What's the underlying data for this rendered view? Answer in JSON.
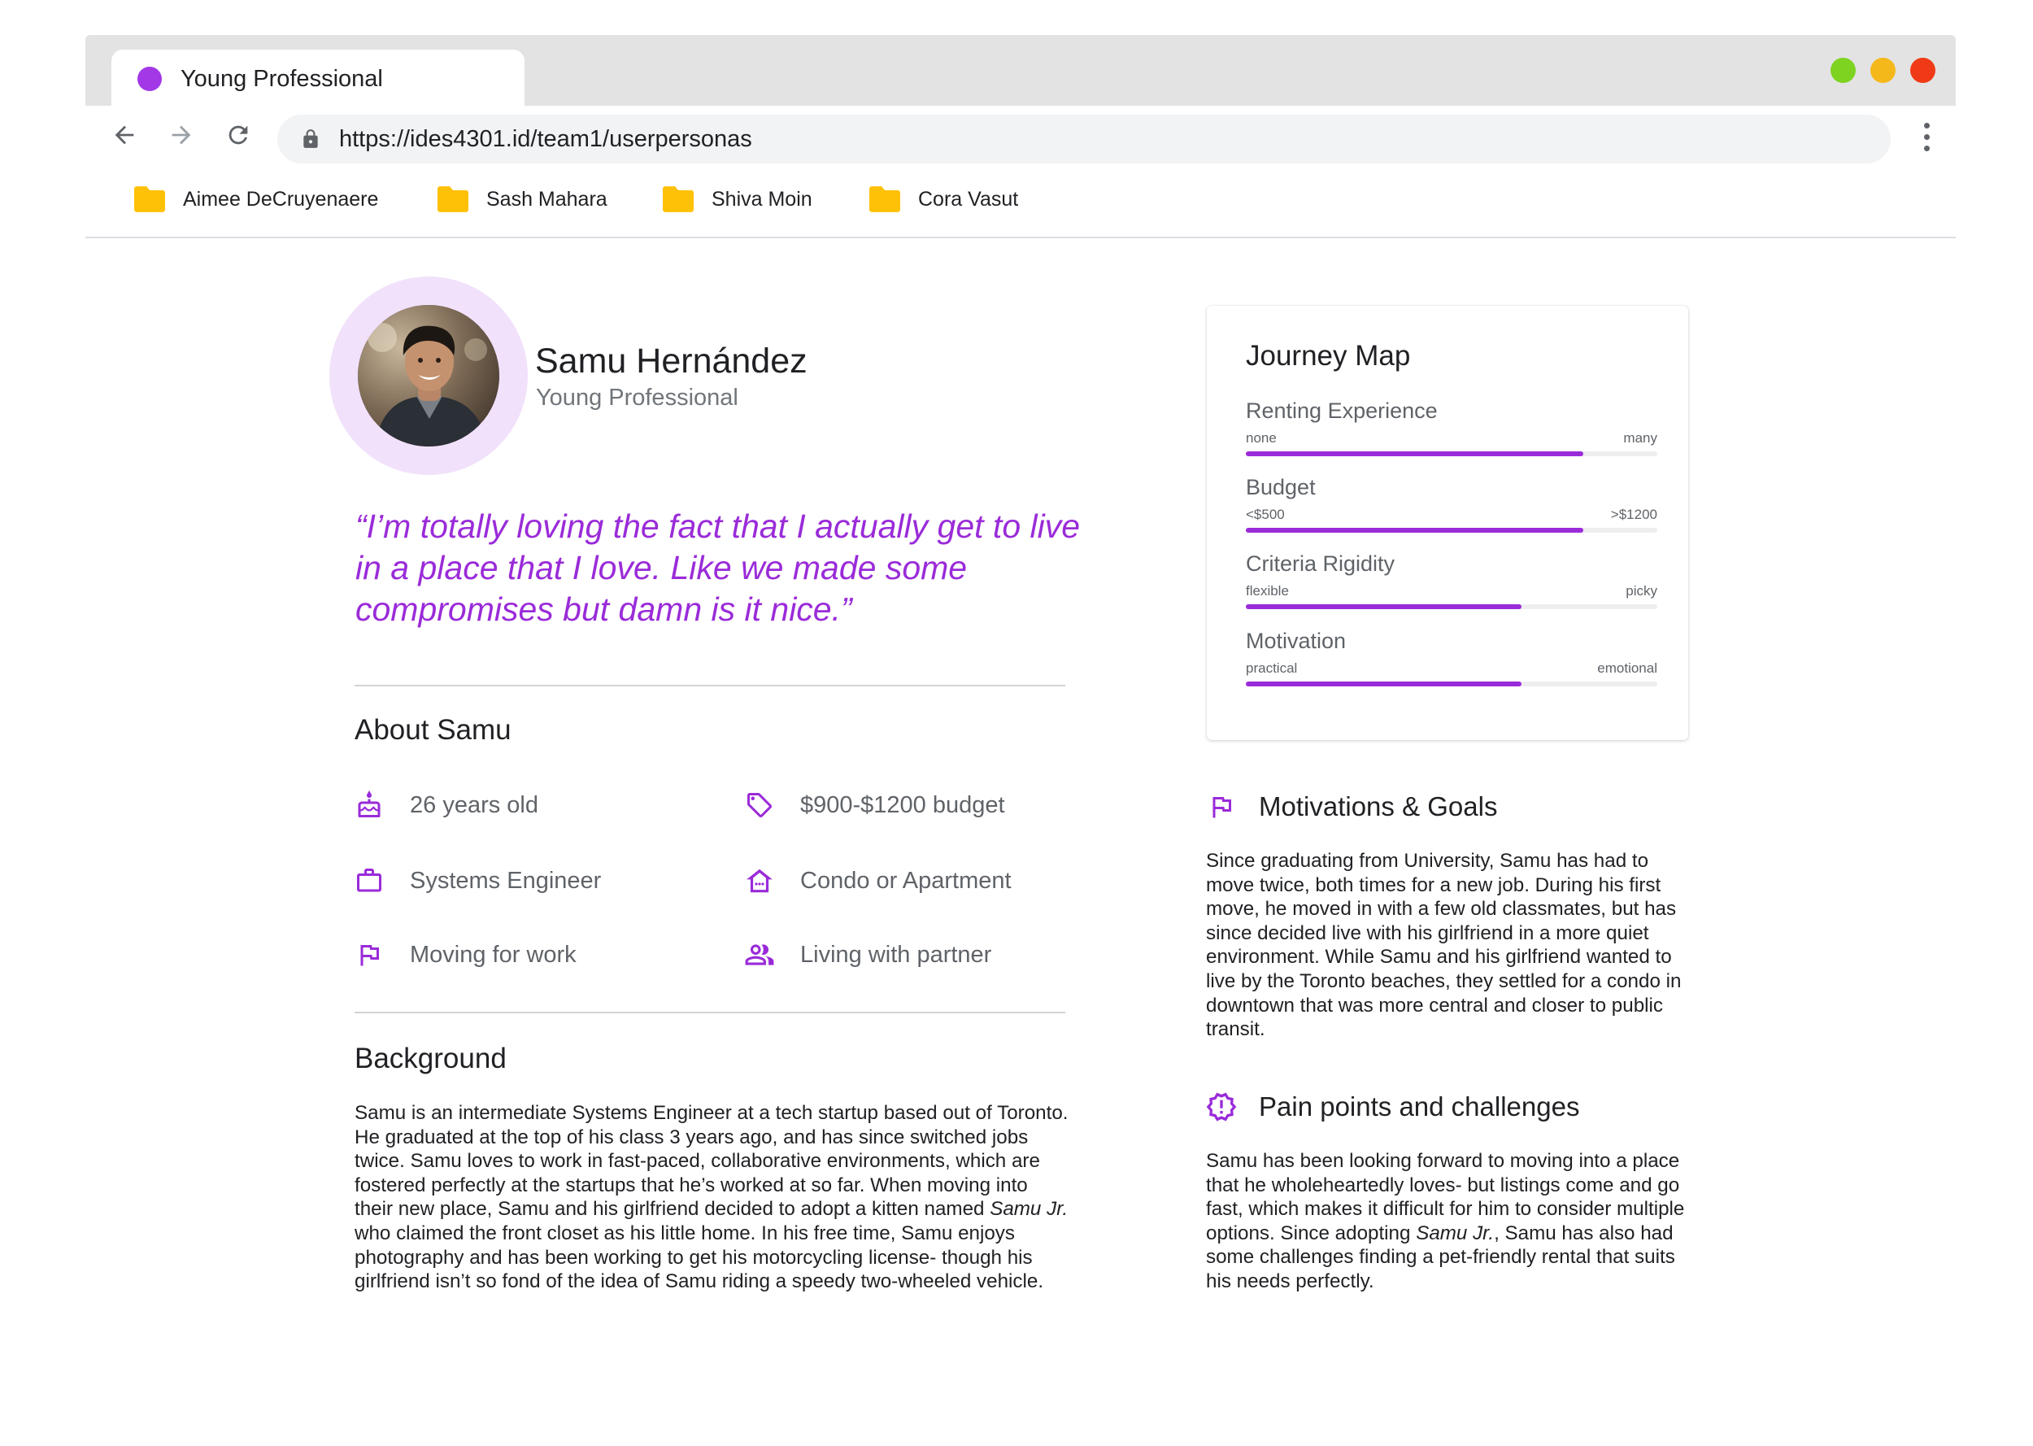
{
  "browser": {
    "tab_title": "Young Professional",
    "url": "https://ides4301.id/team1/userpersonas",
    "bookmarks": [
      {
        "label": "Aimee DeCruyenaere",
        "icon": "folder-icon"
      },
      {
        "label": "Sash Mahara",
        "icon": "folder-icon"
      },
      {
        "label": "Shiva Moin",
        "icon": "folder-icon"
      },
      {
        "label": "Cora Vasut",
        "icon": "folder-icon"
      }
    ],
    "colors": {
      "tab_dot": "#a238e6",
      "folder": "#ffc107",
      "close": "#f03a17",
      "minimize": "#f5b81a",
      "maximize": "#7ed321"
    }
  },
  "persona": {
    "name": "Samu Hernández",
    "role": "Young Professional",
    "quote": "“I’m totally loving the fact that I actually get to live in a place that I love. Like we made some compromises but damn is it nice.”",
    "accent_color": "#9a2bd9",
    "about": {
      "title": "About Samu",
      "facts": [
        {
          "icon": "birthday-cake-icon",
          "text": "26 years old"
        },
        {
          "icon": "price-tag-icon",
          "text": "$900-$1200 budget"
        },
        {
          "icon": "briefcase-icon",
          "text": "Systems Engineer"
        },
        {
          "icon": "house-icon",
          "text": "Condo or Apartment"
        },
        {
          "icon": "flag-icon",
          "text": "Moving for work"
        },
        {
          "icon": "people-icon",
          "text": "Living with partner"
        }
      ]
    },
    "background": {
      "title": "Background",
      "text_before": "Samu is an intermediate Systems Engineer at a tech startup based out of Toronto. He graduated at the top of his class 3 years ago, and has since switched jobs twice. Samu loves to work in fast-paced, collaborative environments, which are fostered perfectly at the startups that he’s worked at so far. When moving into their new place, Samu and his girlfriend decided to adopt a kitten named ",
      "text_em": "Samu Jr.",
      "text_after": " who claimed the front closet as his little home. In his free time, Samu enjoys photography and has been working to get his motorcycling license- though his girlfriend isn’t so fond of the idea of Samu riding a speedy two-wheeled vehicle."
    },
    "journey_map": {
      "title": "Journey Map",
      "metrics": [
        {
          "label": "Renting Experience",
          "min": "none",
          "max": "many",
          "value": 0.82
        },
        {
          "label": "Budget",
          "min": "<$500",
          "max": ">$1200",
          "value": 0.82
        },
        {
          "label": "Criteria Rigidity",
          "min": "flexible",
          "max": "picky",
          "value": 0.67
        },
        {
          "label": "Motivation",
          "min": "practical",
          "max": "emotional",
          "value": 0.67
        }
      ]
    },
    "motivations": {
      "title": "Motivations & Goals",
      "icon": "flag-icon",
      "text": "Since graduating from University, Samu has had to move twice, both times for a new job. During his first move, he moved in with a few old classmates, but has since decided live with his girlfriend in a more quiet environment. While Samu and his girlfriend wanted to live by the Toronto beaches, they settled for a condo in downtown that was more central and closer to public transit."
    },
    "pain_points": {
      "title": "Pain points and challenges",
      "icon": "alert-badge-icon",
      "text_before": "Samu has been looking forward to moving into a place that he wholeheartedly loves- but listings come and go fast, which makes it difficult for him to consider multiple options. Since adopting ",
      "text_em": "Samu Jr.",
      "text_after": ", Samu has also had some challenges finding a pet-friendly rental that suits his needs perfectly."
    }
  }
}
